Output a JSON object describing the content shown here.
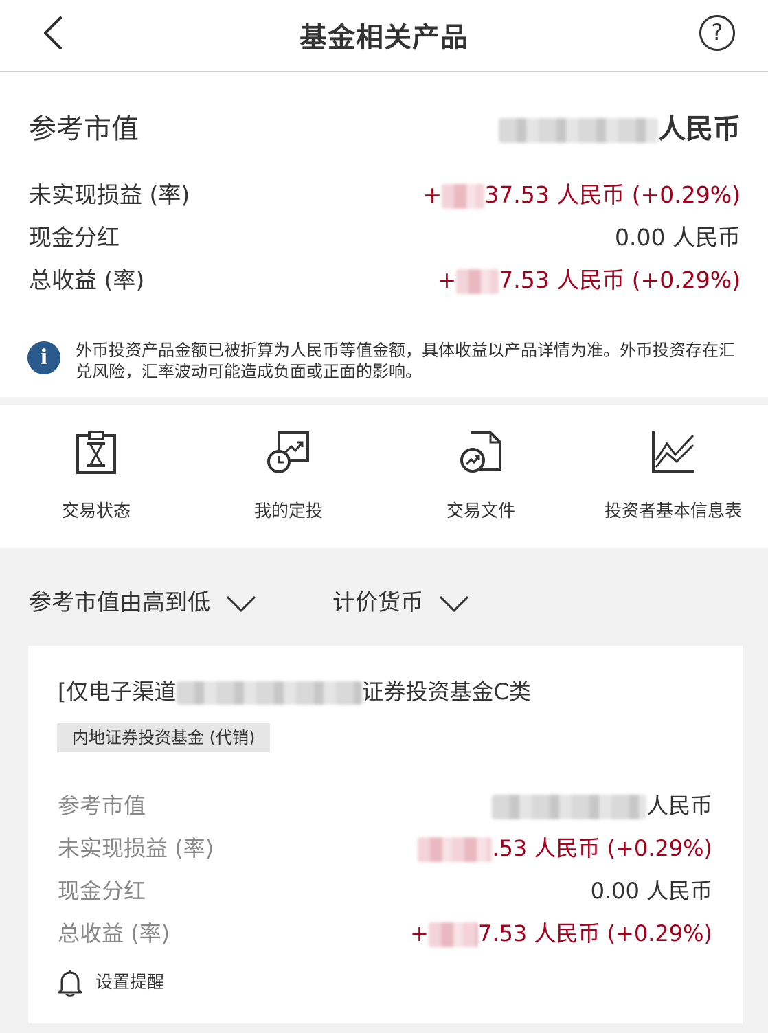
{
  "header": {
    "title": "基金相关产品",
    "back_icon": "chevron-left-icon",
    "help_icon": "question-circle-icon",
    "help_glyph": "?"
  },
  "summary": {
    "market_value_label": "参考市值",
    "market_value_currency": "人民币",
    "unrealized_label": "未实现损益 (率)",
    "unrealized_prefix": "+",
    "unrealized_value": "37.53 人民币 (+0.29%)",
    "dividend_label": "现金分红",
    "dividend_value": "0.00 人民币",
    "total_label": "总收益 (率)",
    "total_prefix": "+",
    "total_value": "7.53 人民币 (+0.29%)"
  },
  "notice": {
    "icon_glyph": "i",
    "text": "外币投资产品金额已被折算为人民币等值金额，具体收益以产品详情为准。外币投资存在汇兑风险，汇率波动可能造成负面或正面的影响。"
  },
  "quick_actions": [
    {
      "label": "交易状态",
      "icon": "hourglass-clipboard-icon"
    },
    {
      "label": "我的定投",
      "icon": "scheduled-investment-icon"
    },
    {
      "label": "交易文件",
      "icon": "trade-document-icon"
    },
    {
      "label": "投资者基本信息表",
      "icon": "line-chart-icon"
    }
  ],
  "filters": {
    "sort_label": "参考市值由高到低",
    "currency_label": "计价货币"
  },
  "fund_card": {
    "title_prefix": "[仅电子渠道",
    "title_suffix": "证券投资基金C类",
    "tag": "内地证券投资基金 (代销)",
    "market_value_label": "参考市值",
    "market_value_currency": "人民币",
    "unrealized_label": "未实现损益 (率)",
    "unrealized_value": ".53 人民币 (+0.29%)",
    "dividend_label": "现金分红",
    "dividend_value": "0.00 人民币",
    "total_label": "总收益 (率)",
    "total_prefix": "+",
    "total_value": "7.53 人民币 (+0.29%)",
    "reminder_label": "设置提醒"
  },
  "colors": {
    "accent_red": "#a8001c",
    "info_blue": "#2a5a8c",
    "background": "#f2f2f2"
  }
}
